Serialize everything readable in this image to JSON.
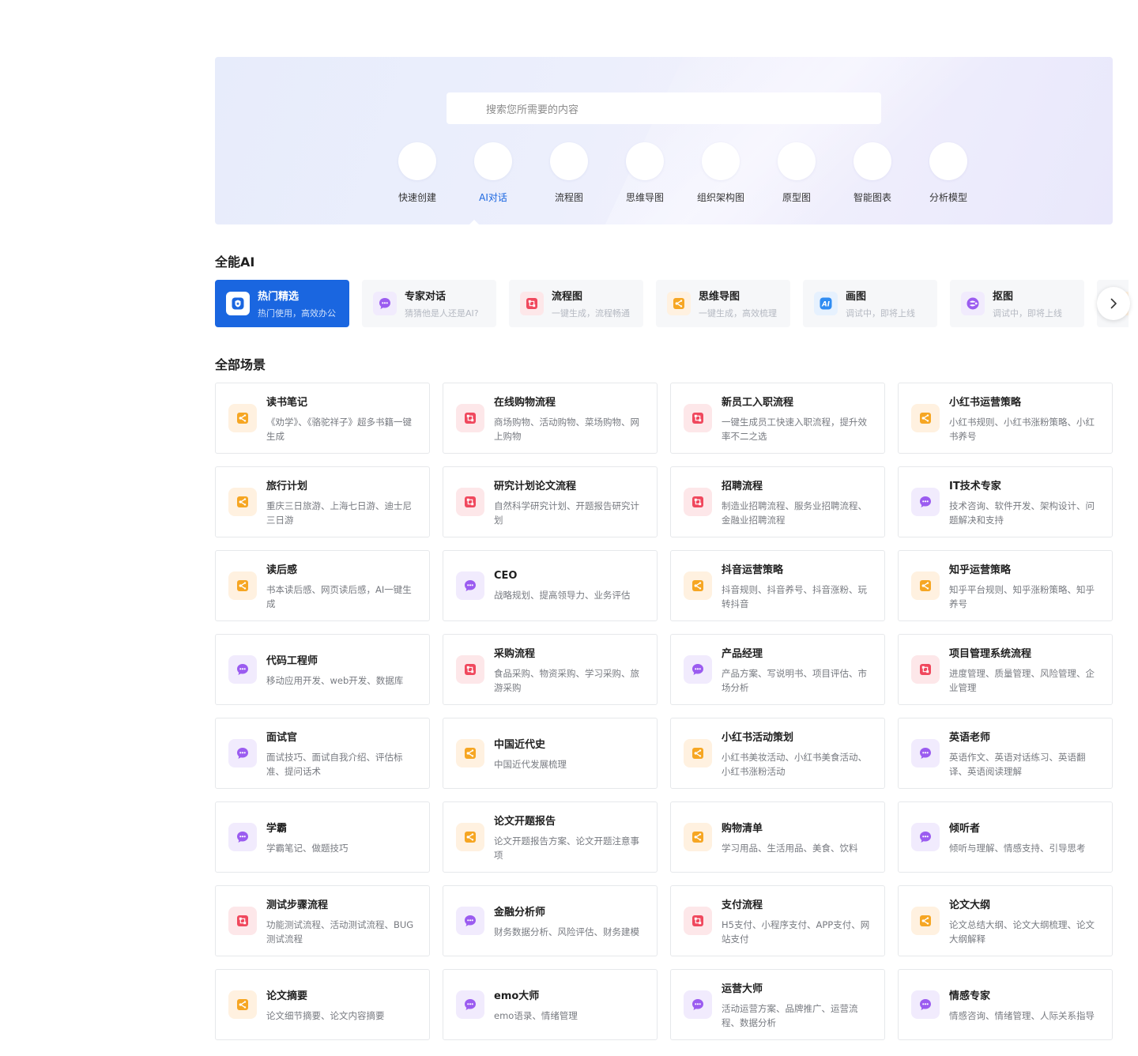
{
  "search": {
    "placeholder": "搜索您所需要的内容"
  },
  "tools": [
    {
      "label": "快速创建",
      "active": false
    },
    {
      "label": "AI对话",
      "active": true
    },
    {
      "label": "流程图",
      "active": false
    },
    {
      "label": "思维导图",
      "active": false
    },
    {
      "label": "组织架构图",
      "active": false
    },
    {
      "label": "原型图",
      "active": false
    },
    {
      "label": "智能图表",
      "active": false
    },
    {
      "label": "分析模型",
      "active": false
    }
  ],
  "sections": {
    "all_ai": "全能AI",
    "all_scenes": "全部场景"
  },
  "tabs": [
    {
      "title": "热门精选",
      "desc": "热门使用，高效办公",
      "icon": "badge-icon",
      "active": true
    },
    {
      "title": "专家对话",
      "desc": "猜猜他是人还是AI?",
      "icon": "chat-icon",
      "active": false
    },
    {
      "title": "流程图",
      "desc": "一键生成，流程畅通",
      "icon": "flowchart-icon",
      "active": false
    },
    {
      "title": "思维导图",
      "desc": "一键生成，高效梳理",
      "icon": "mindmap-icon",
      "active": false
    },
    {
      "title": "画图",
      "desc": "调试中，即将上线",
      "icon": "ai-paint-icon",
      "active": false
    },
    {
      "title": "抠图",
      "desc": "调试中，即将上线",
      "icon": "cutout-icon",
      "active": false
    },
    {
      "title": "",
      "desc": "",
      "icon": "more-icon",
      "active": false
    }
  ],
  "scenes": [
    {
      "title": "读书笔记",
      "desc": "《劝学》、《骆驼祥子》超多书籍一键生成",
      "color": "orange"
    },
    {
      "title": "在线购物流程",
      "desc": "商场购物、活动购物、菜场购物、网上购物",
      "color": "red"
    },
    {
      "title": "新员工入职流程",
      "desc": "一键生成员工快速入职流程，提升效率不二之选",
      "color": "red"
    },
    {
      "title": "小红书运营策略",
      "desc": "小红书规则、小红书涨粉策略、小红书养号",
      "color": "orange"
    },
    {
      "title": "旅行计划",
      "desc": "重庆三日旅游、上海七日游、迪士尼三日游",
      "color": "orange"
    },
    {
      "title": "研究计划论文流程",
      "desc": "自然科学研究计划、开题报告研究计划",
      "color": "red"
    },
    {
      "title": "招聘流程",
      "desc": "制造业招聘流程、服务业招聘流程、金融业招聘流程",
      "color": "red"
    },
    {
      "title": "IT技术专家",
      "desc": "技术咨询、软件开发、架构设计、问题解决和支持",
      "color": "purple"
    },
    {
      "title": "读后感",
      "desc": "书本读后感、网页读后感，AI一键生成",
      "color": "orange"
    },
    {
      "title": "CEO",
      "desc": "战略规划、提高领导力、业务评估",
      "color": "purple"
    },
    {
      "title": "抖音运营策略",
      "desc": "抖音规则、抖音养号、抖音涨粉、玩转抖音",
      "color": "orange"
    },
    {
      "title": "知乎运营策略",
      "desc": "知乎平台规则、知乎涨粉策略、知乎养号",
      "color": "orange"
    },
    {
      "title": "代码工程师",
      "desc": "移动应用开发、web开发、数据库",
      "color": "purple"
    },
    {
      "title": "采购流程",
      "desc": "食品采购、物资采购、学习采购、旅游采购",
      "color": "red"
    },
    {
      "title": "产品经理",
      "desc": "产品方案、写说明书、项目评估、市场分析",
      "color": "purple"
    },
    {
      "title": "项目管理系统流程",
      "desc": "进度管理、质量管理、风险管理、企业管理",
      "color": "red"
    },
    {
      "title": "面试官",
      "desc": "面试技巧、面试自我介绍、评估标准、提问话术",
      "color": "purple"
    },
    {
      "title": "中国近代史",
      "desc": "中国近代发展梳理",
      "color": "orange"
    },
    {
      "title": "小红书活动策划",
      "desc": "小红书美妆活动、小红书美食活动、小红书涨粉活动",
      "color": "orange"
    },
    {
      "title": "英语老师",
      "desc": "英语作文、英语对话练习、英语翻译、英语阅读理解",
      "color": "purple"
    },
    {
      "title": "学霸",
      "desc": "学霸笔记、做题技巧",
      "color": "purple"
    },
    {
      "title": "论文开题报告",
      "desc": "论文开题报告方案、论文开题注意事项",
      "color": "orange"
    },
    {
      "title": "购物清单",
      "desc": "学习用品、生活用品、美食、饮料",
      "color": "orange"
    },
    {
      "title": "倾听者",
      "desc": "倾听与理解、情感支持、引导思考",
      "color": "purple"
    },
    {
      "title": "测试步骤流程",
      "desc": "功能测试流程、活动测试流程、BUG测试流程",
      "color": "red"
    },
    {
      "title": "金融分析师",
      "desc": "财务数据分析、风险评估、财务建模",
      "color": "purple"
    },
    {
      "title": "支付流程",
      "desc": "H5支付、小程序支付、APP支付、网站支付",
      "color": "red"
    },
    {
      "title": "论文大纲",
      "desc": "论文总结大纲、论文大纲梳理、论文大纲解释",
      "color": "orange"
    },
    {
      "title": "论文摘要",
      "desc": "论文细节摘要、论文内容摘要",
      "color": "orange"
    },
    {
      "title": "emo大师",
      "desc": "emo语录、情绪管理",
      "color": "purple"
    },
    {
      "title": "运营大师",
      "desc": "活动运营方案、品牌推广、运营流程、数据分析",
      "color": "purple"
    },
    {
      "title": "情感专家",
      "desc": "情感咨询、情绪管理、人际关系指导",
      "color": "purple"
    }
  ]
}
